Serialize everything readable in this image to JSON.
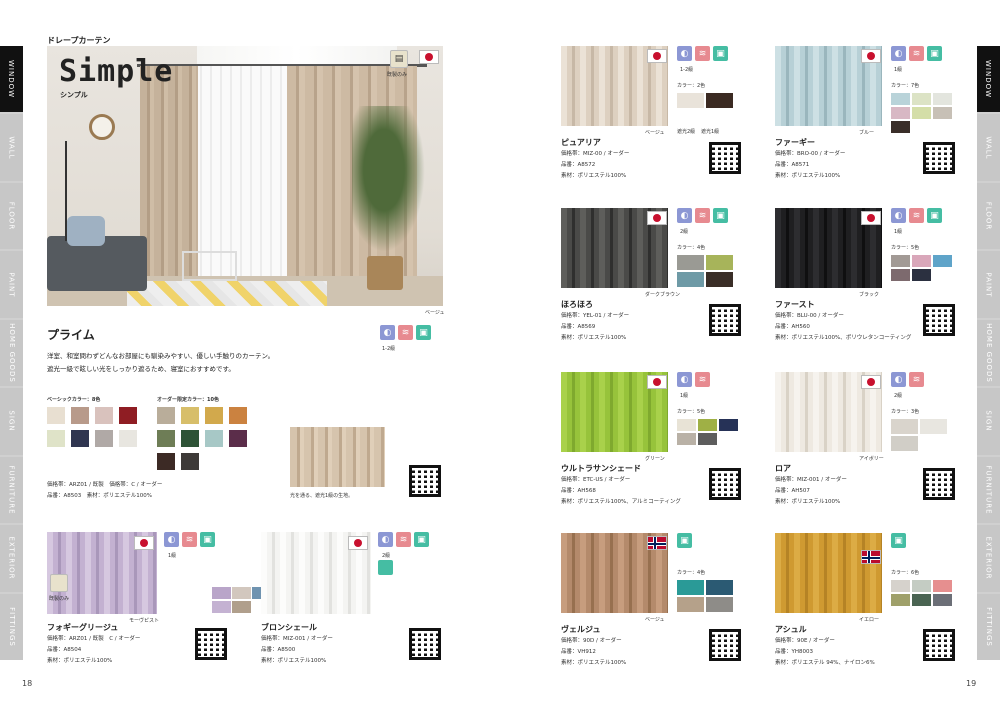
{
  "section": "ドレープカーテン",
  "pages": {
    "left": "18",
    "right": "19"
  },
  "tabs": [
    "WINDOW",
    "WALL",
    "FLOOR",
    "PAINT",
    "HOME GOODS",
    "SIGN",
    "FURNITURE",
    "EXTERIOR",
    "FITTINGS"
  ],
  "hero": {
    "title": "Simple",
    "subtitle": "シンプル",
    "badge": "既製のみ",
    "color_caption": "ベージュ"
  },
  "prime": {
    "name": "プライム",
    "grade": "1-2級",
    "desc1": "洋室、和室問わずどんなお部屋にも馴染みやすい、優しい手触りのカーテン。",
    "desc2": "遮光一級で眩しい光をしっかり遮るため、寝室におすすめです。",
    "basic_label": "ベーシックカラー：8色",
    "order_label": "オーダー限定カラー：10色",
    "basic_colors": [
      "#e8dfd1",
      "#b89a8a",
      "#d9c2bd",
      "#8f1d23",
      "#dfe3c8",
      "#2f3550",
      "#b0a9a6",
      "#e8e6e0"
    ],
    "order_colors": [
      "#b9ad9a",
      "#d7be6a",
      "#d2a94c",
      "#cb8240",
      "#6e7d56",
      "#2e5336",
      "#a7c8c6",
      "#5b2d4a",
      "#3c2a25",
      "#3d3a38"
    ],
    "photo_caption": "光を通る、遮光1級の生地。",
    "spec1": "価格帯：ARZ01 / 既製　価格帯：C / オーダー",
    "spec2": "品番：A8503　素材：ポリエステル100%"
  },
  "left_products": [
    {
      "name": "フォギーグリージュ",
      "grade": "1級",
      "badge": "既製のみ",
      "color_caption": "モーヴピスト",
      "colors": [
        "#b9a5c9",
        "#d2c7be",
        "#6f93b0",
        "#c4b2d2",
        "#b09f8c"
      ],
      "spec1": "価格帯：ARZ01 / 既製　C / オーダー",
      "spec2": "品番：A8504",
      "spec3": "素材：ポリエステル100%"
    },
    {
      "name": "ブロンシェール",
      "grade": "2級",
      "color_caption": "",
      "colors": [],
      "spec1": "価格帯：MIZ-001 / オーダー",
      "spec2": "品番：A8500",
      "spec3": "素材：ポリエステル100%"
    }
  ],
  "right_products": [
    {
      "name": "ピュアリア",
      "grade": "1-2級",
      "count": "カラー：2色",
      "caption": "ベージュ",
      "swatch_captions": [
        "遮光2級",
        "遮光1級"
      ],
      "colors": [
        "#e9e3da",
        "#3b2a22"
      ],
      "spec1": "価格帯：MIZ-00 / オーダー",
      "spec2": "品番：A8572",
      "spec3": "素材：ポリエステル100%"
    },
    {
      "name": "ファーギー",
      "grade": "1級",
      "count": "カラー：7色",
      "caption": "ブルー",
      "swatch_captions": [],
      "colors": [
        "#b9d3d9",
        "#dce3c5",
        "#e3e5de",
        "#d8b8c4",
        "#d4dea8",
        "#c7c0b6",
        "#3a2e29"
      ],
      "spec1": "価格帯：BRO-00 / オーダー",
      "spec2": "品番：A8571",
      "spec3": "素材：ポリエステル100%"
    },
    {
      "name": "ほろほろ",
      "grade": "2級",
      "count": "カラー：4色",
      "caption": "ダークブラウン",
      "swatch_captions": [],
      "colors": [
        "#9a9a94",
        "#a7b45a",
        "#6e9aa6",
        "#3a2e27"
      ],
      "spec1": "価格帯：YEL-01 / オーダー",
      "spec2": "品番：A8569",
      "spec3": "素材：ポリエステル100%"
    },
    {
      "name": "ファースト",
      "grade": "1級",
      "count": "カラー：5色",
      "caption": "ブラック",
      "swatch_captions": [],
      "colors": [
        "#a29a95",
        "#d9a7ba",
        "#5fa4c9",
        "#7d6a6e",
        "#2b3040"
      ],
      "spec1": "価格帯：BLU-00 / オーダー",
      "spec2": "品番：AH560",
      "spec3": "素材：ポリエステル100%、ポリウレタンコーティング"
    },
    {
      "name": "ウルトラサンシェード",
      "grade": "1級",
      "count": "カラー：5色",
      "caption": "グリーン",
      "swatch_captions": [],
      "colors": [
        "#e8e3d6",
        "#9fb045",
        "#263257",
        "#b9b1a6",
        "#5d5d5d"
      ],
      "spec1": "価格帯：ETC-US / オーダー",
      "spec2": "品番：AH568",
      "spec3": "素材：ポリエステル100%、アルミコーティング"
    },
    {
      "name": "ロア",
      "grade": "2級",
      "count": "カラー：3色",
      "caption": "アイボリー",
      "swatch_captions": [],
      "colors": [
        "#d9d4cc",
        "#e8e6e0",
        "#d1cec7"
      ],
      "spec1": "価格帯：MIZ-001 / オーダー",
      "spec2": "品番：AH507",
      "spec3": "素材：ポリエステル100%"
    },
    {
      "name": "ヴェルジュ",
      "grade": "",
      "count": "カラー：4色",
      "caption": "ベージュ",
      "swatch_captions": [],
      "colors": [
        "#2a9a97",
        "#2b5a73",
        "#b5a18a",
        "#8e8c88"
      ],
      "spec1": "価格帯：90D / オーダー",
      "spec2": "品番：VH912",
      "spec3": "素材：ポリエステル100%"
    },
    {
      "name": "アシュル",
      "grade": "",
      "count": "カラー：6色",
      "caption": "イエロー",
      "swatch_captions": [],
      "colors": [
        "#d6d2cc",
        "#c4ccc3",
        "#e68f8f",
        "#9fa06a",
        "#4a6452",
        "#6c6f77"
      ],
      "spec1": "価格帯：90E / オーダー",
      "spec2": "品番：YH8003",
      "spec3": "素材：ポリエステル 94%、ナイロン6%"
    }
  ]
}
